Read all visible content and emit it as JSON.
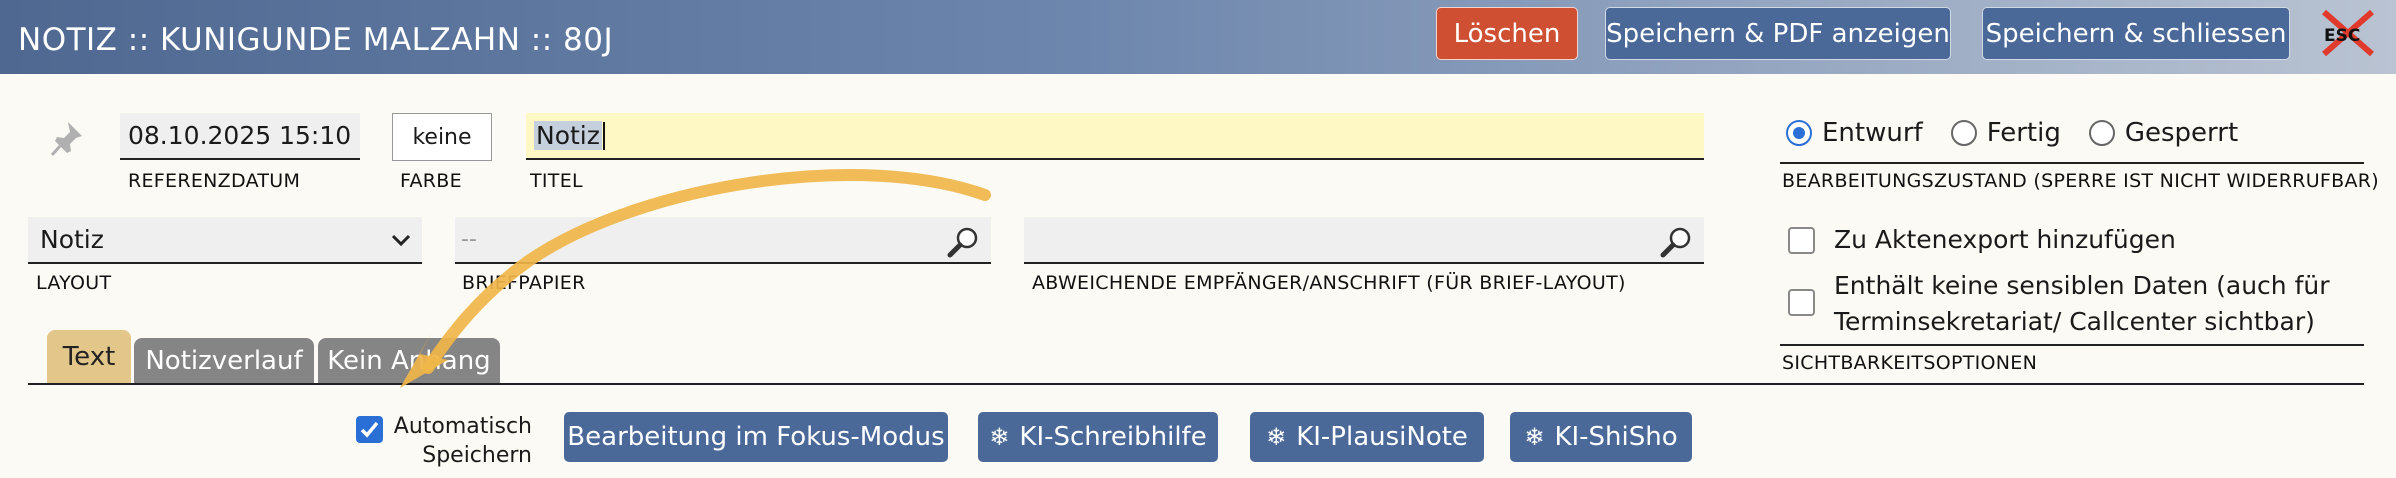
{
  "header": {
    "title": "NOTIZ :: KUNIGUNDE MALZAHN :: 80J",
    "delete_label": "Löschen",
    "save_pdf_label": "Speichern & PDF anzeigen",
    "save_close_label": "Speichern & schliessen",
    "esc_label": "ESC"
  },
  "fields": {
    "date_value": "08.10.2025 15:10",
    "date_label": "REFERENZDATUM",
    "color_value": "keine",
    "color_label": "FARBE",
    "title_value": "Notiz",
    "title_label": "TITEL",
    "layout_value": "Notiz",
    "layout_label": "LAYOUT",
    "brief_value": "--",
    "brief_label": "BRIEFPAPIER",
    "empf_value": "",
    "empf_label": "ABWEICHENDE EMPFÄNGER/ANSCHRIFT (FÜR BRIEF-LAYOUT)"
  },
  "status": {
    "options": [
      "Entwurf",
      "Fertig",
      "Gesperrt"
    ],
    "selected": "Entwurf",
    "label": "BEARBEITUNGSZUSTAND (SPERRE IST NICHT WIDERRUFBAR)"
  },
  "visibility": {
    "export_label": "Zu Aktenexport hinzufügen",
    "sensitive_line1": "Enthält keine sensiblen Daten (auch für",
    "sensitive_line2": "Terminsekretariat/ Callcenter sichtbar)",
    "label": "SICHTBARKEITSOPTIONEN"
  },
  "tabs": [
    {
      "label": "Text",
      "active": true
    },
    {
      "label": "Notizverlauf",
      "active": false
    },
    {
      "label": "Kein Anhang",
      "active": false
    }
  ],
  "toolbar": {
    "autosave_line1": "Automatisch",
    "autosave_line2": "Speichern",
    "autosave_checked": true,
    "fokus_label": "Bearbeitung im Fokus-Modus",
    "ki1_label": "KI-Schreibhilfe",
    "ki2_label": "KI-PlausiNote",
    "ki3_label": "KI-ShiSho"
  },
  "colors": {
    "header_start": "#4e6891",
    "delete": "#cf4f33",
    "button": "#4a6898",
    "title_bg": "#fdf8c4",
    "active_tab": "#e3c68a",
    "arrow": "#f0b64a"
  }
}
